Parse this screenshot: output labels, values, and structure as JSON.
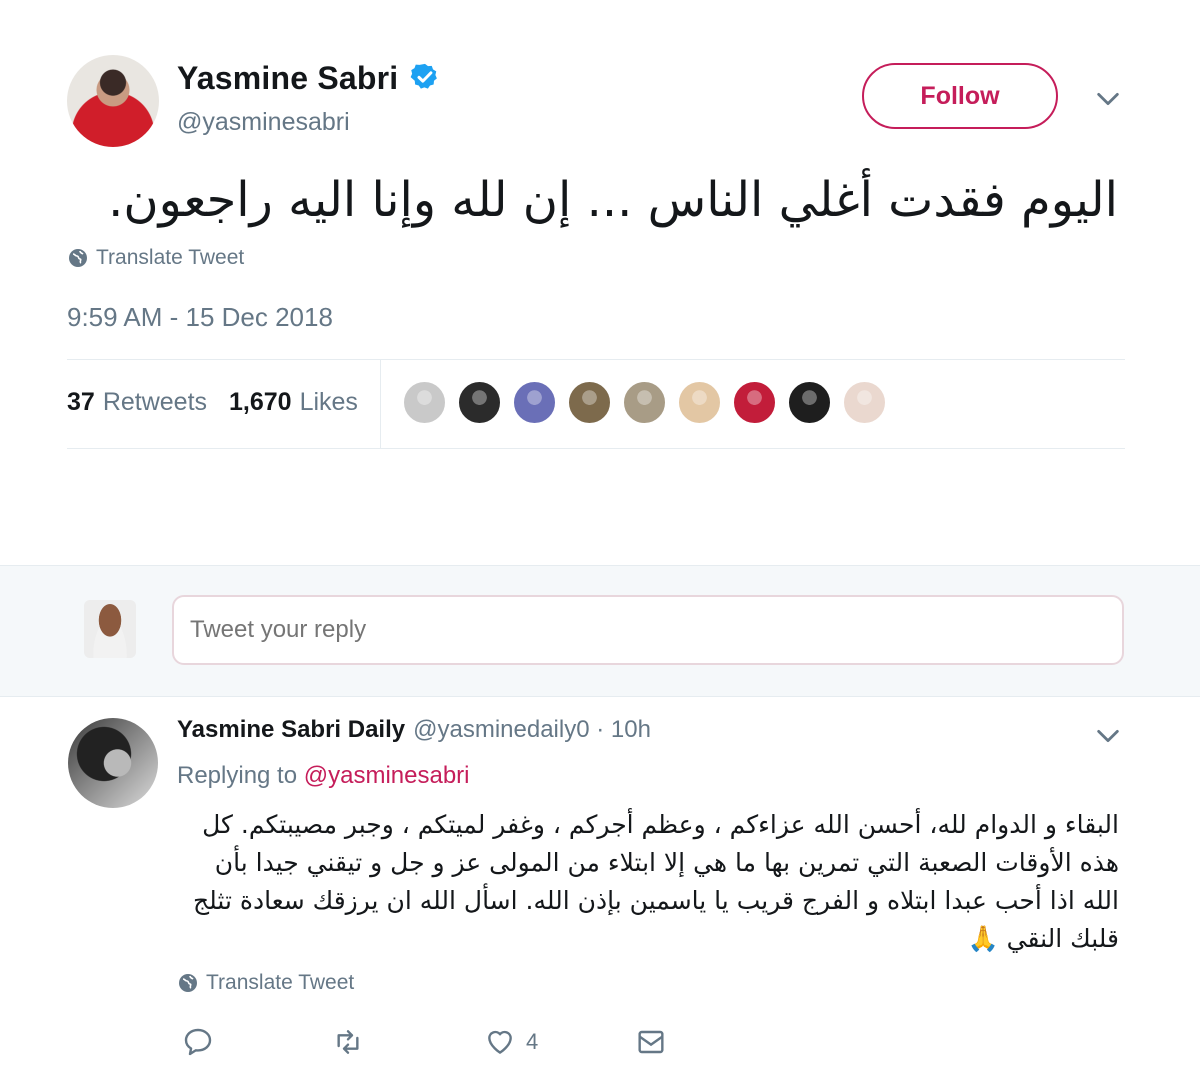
{
  "tweet": {
    "author_name": "Yasmine Sabri",
    "author_handle": "@yasminesabri",
    "follow_label": "Follow",
    "text": "اليوم فقدت أغلي الناس ... إن لله وإنا اليه راجعون.",
    "translate_label": "Translate Tweet",
    "timestamp": "9:59 AM - 15 Dec 2018",
    "retweets_count": "37",
    "retweets_label": "Retweets",
    "likes_count": "1,670",
    "likes_label": "Likes",
    "liker_avatars": [
      "#c9c9c9",
      "#2b2b2b",
      "#6a6fb7",
      "#7d6a4c",
      "#a89c86",
      "#e3c7a4",
      "#c21d3a",
      "#1e1e1e",
      "#ead8cf"
    ]
  },
  "composer": {
    "placeholder": "Tweet your reply"
  },
  "reply": {
    "author_name": "Yasmine Sabri Daily",
    "meta": "@yasminedaily0 · 10h",
    "replying_prefix": "Replying to",
    "replying_to": "@yasminesabri",
    "text": "البقاء و الدوام لله، أحسن الله عزاءكم ، وعظم أجركم ، وغفر لميتكم ، وجبر مصيبتكم. كل هذه الأوقات الصعبة التي تمرين بها ما هي إلا ابتلاء من المولى عز و جل و تيقني جيدا بأن الله اذا أحب عبدا ابتلاه و الفرج قريب يا ياسمين بإذن الله. اسأل الله ان يرزقك سعادة تثلج قلبك النقي 🙏",
    "translate_label": "Translate Tweet",
    "likes_count": "4"
  },
  "colors": {
    "accent": "#c51d5a",
    "verified": "#1da1f2",
    "muted": "#657786"
  },
  "icons": {
    "verified": "verified-badge-icon",
    "translate": "globe-icon",
    "reply": "reply-icon",
    "retweet": "retweet-icon",
    "like": "heart-icon",
    "message": "envelope-icon",
    "more": "chevron-down-icon"
  }
}
